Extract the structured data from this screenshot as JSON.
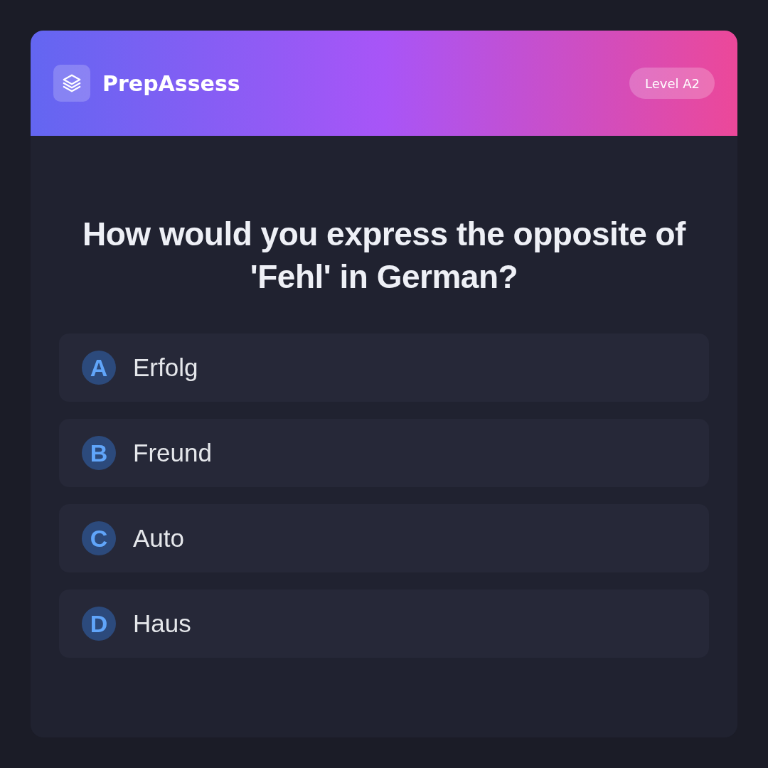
{
  "header": {
    "app_name": "PrepAssess",
    "level_badge": "Level A2"
  },
  "question": {
    "text": "How would you express the opposite of 'Fehl' in German?"
  },
  "options": [
    {
      "letter": "A",
      "text": "Erfolg"
    },
    {
      "letter": "B",
      "text": "Freund"
    },
    {
      "letter": "C",
      "text": "Auto"
    },
    {
      "letter": "D",
      "text": "Haus"
    }
  ]
}
